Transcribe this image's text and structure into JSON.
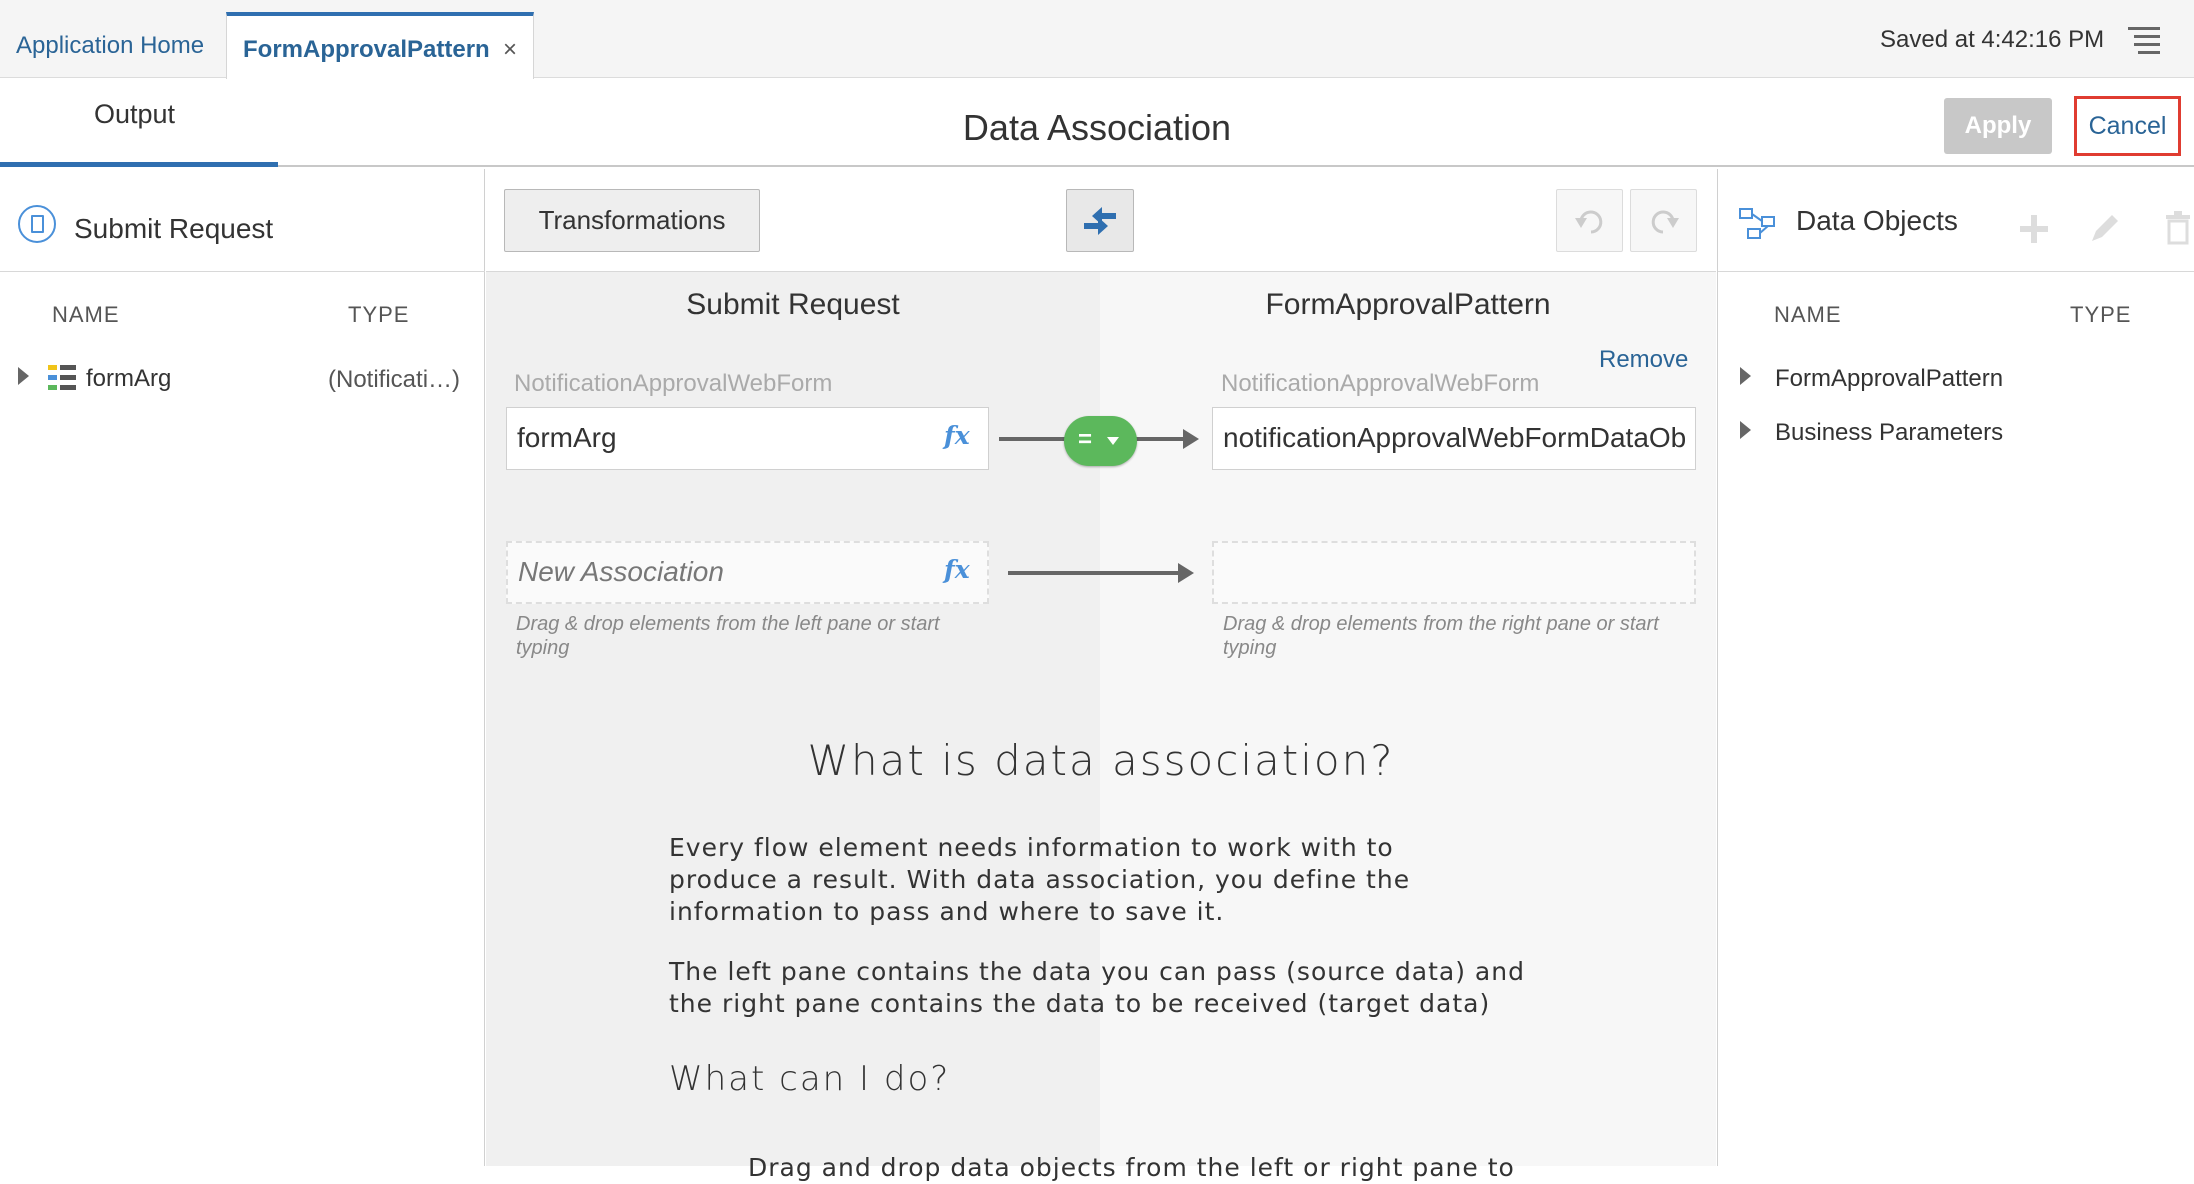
{
  "tabs": {
    "home_label": "Application Home",
    "active_label": "FormApprovalPattern",
    "close_glyph": "×"
  },
  "status": {
    "saved": "Saved at 4:42:16 PM"
  },
  "header": {
    "output_tab": "Output",
    "title": "Data Association",
    "apply_label": "Apply",
    "cancel_label": "Cancel"
  },
  "left_pane": {
    "title": "Submit Request",
    "col_name": "NAME",
    "col_type": "TYPE",
    "rows": [
      {
        "label": "formArg",
        "type": "(Notificati…)"
      }
    ]
  },
  "center": {
    "transform_label": "Transformations",
    "source_title": "Submit Request",
    "target_title": "FormApprovalPattern",
    "remove_label": "Remove",
    "source_type": "NotificationApprovalWebForm",
    "target_type": "NotificationApprovalWebForm",
    "source_value": "formArg",
    "target_value": "notificationApprovalWebFormDataOb",
    "operator": "=",
    "new_assoc_placeholder": "New Association",
    "fx_label": "fx",
    "hint_left": "Drag & drop elements from the left pane or start typing",
    "hint_right": "Drag & drop elements from the right pane or start typing",
    "help_title": "What is data association?",
    "help_p1": "Every flow element needs information to work with to produce a result. With data association, you define the information to pass and where to save it.",
    "help_p2": "The left pane contains the data you can pass (source data) and the right pane contains the data to be received (target data)",
    "help_subtitle": "What can I do?",
    "help_cut": "Drag and drop data objects from the left or right pane to"
  },
  "right_pane": {
    "title": "Data Objects",
    "col_name": "NAME",
    "col_type": "TYPE",
    "rows": [
      {
        "label": "FormApprovalPattern"
      },
      {
        "label": "Business Parameters"
      }
    ]
  },
  "colors": {
    "accent": "#2f6fb0",
    "link": "#2a6496",
    "cancel_border": "#e03c31",
    "operator_green": "#5cb85c"
  }
}
